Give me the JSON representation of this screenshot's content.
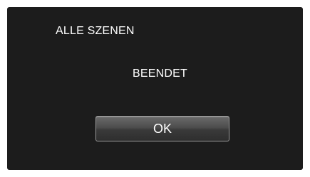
{
  "dialog": {
    "title": "ALLE SZENEN",
    "message": "BEENDET",
    "ok_label": "OK"
  },
  "colors": {
    "screen_background": "#1c1c1c",
    "text": "#ffffff",
    "button_border": "#9a9a9a"
  }
}
